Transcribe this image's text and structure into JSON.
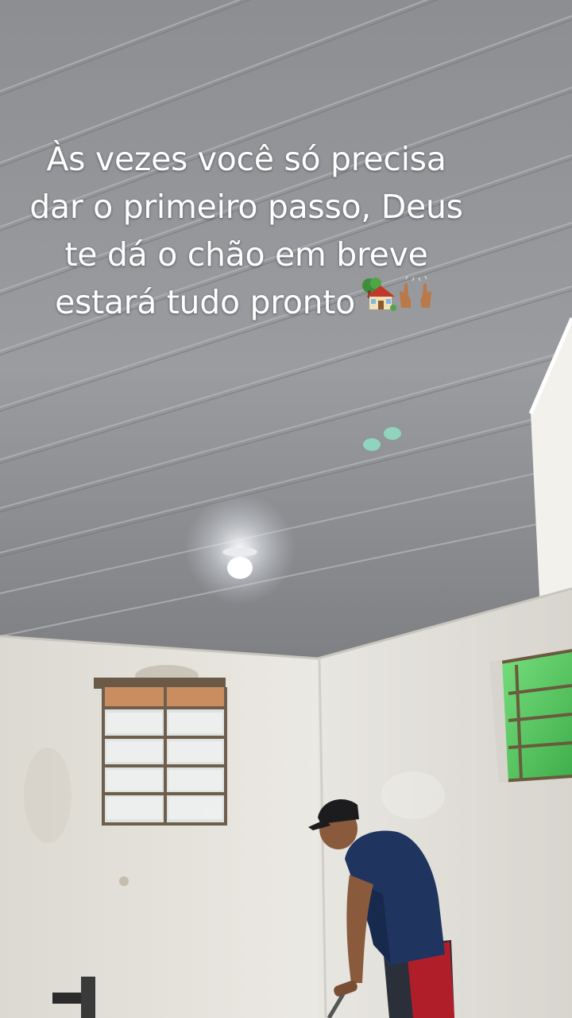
{
  "overlay_text": {
    "line1": "Às vezes você só precisa",
    "line2": "dar o primeiro passo, Deus",
    "line3": "te dá o chão em breve",
    "line4": "estará tudo pronto"
  },
  "emojis": [
    "house-with-garden",
    "raising-hands"
  ],
  "colors": {
    "ceiling": "#8f9195",
    "walls": "#e6e4dd",
    "shirt": "#1f3560",
    "shorts": "#b01e2a",
    "window_green": "#5fd06a"
  }
}
